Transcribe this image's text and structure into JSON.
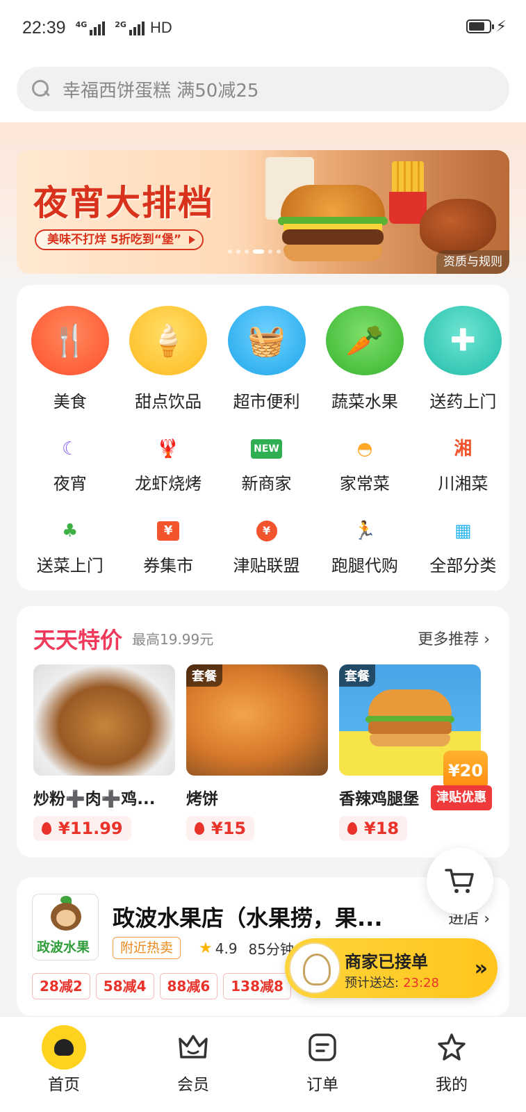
{
  "status_bar": {
    "time": "22:39",
    "network1": "4G",
    "network2": "2G",
    "hd": "HD"
  },
  "search": {
    "placeholder": "幸福西饼蛋糕 满50减25"
  },
  "banner": {
    "title": "夜宵大排档",
    "subtitle": "美味不打烊 5折吃到“堡”",
    "rule_label": "资质与规则",
    "active_dot": 3
  },
  "categories_main": [
    {
      "label": "美食",
      "icon": "spoon-fork-icon",
      "color": "#ff5a3c"
    },
    {
      "label": "甜点饮品",
      "icon": "ice-cream-icon",
      "color": "#ffc22e"
    },
    {
      "label": "超市便利",
      "icon": "basket-icon",
      "color": "#2fb7f0"
    },
    {
      "label": "蔬菜水果",
      "icon": "carrot-icon",
      "color": "#4cc241"
    },
    {
      "label": "送药上门",
      "icon": "medicine-box-icon",
      "color": "#2dc7b5"
    }
  ],
  "categories_row2": [
    {
      "label": "夜宵",
      "icon": "moon-icon",
      "glyph": "☾",
      "color": "#8a5cf5"
    },
    {
      "label": "龙虾烧烤",
      "icon": "lobster-icon",
      "glyph": "🦞",
      "color": "#f2542d"
    },
    {
      "label": "新商家",
      "icon": "new-shop-icon",
      "glyph": "NEW",
      "color": "#2fae52"
    },
    {
      "label": "家常菜",
      "icon": "bowl-icon",
      "glyph": "◓",
      "color": "#ffa726"
    },
    {
      "label": "川湘菜",
      "icon": "xiang-icon",
      "glyph": "湘",
      "color": "#f2542d"
    }
  ],
  "categories_row3": [
    {
      "label": "送菜上门",
      "icon": "broccoli-icon",
      "glyph": "♣",
      "color": "#3cb043"
    },
    {
      "label": "券集市",
      "icon": "coupon-icon",
      "glyph": "¥",
      "color": "#f2542d"
    },
    {
      "label": "津贴联盟",
      "icon": "money-bag-icon",
      "glyph": "¥",
      "color": "#f2542d"
    },
    {
      "label": "跑腿代购",
      "icon": "runner-icon",
      "glyph": "🏃",
      "color": "#f2542d"
    },
    {
      "label": "全部分类",
      "icon": "grid-icon",
      "glyph": "▦",
      "color": "#2fb7f0"
    }
  ],
  "deals": {
    "title": "天天特价",
    "subtitle": "最高19.99元",
    "more": "更多推荐 ›",
    "items": [
      {
        "name": "炒粉➕肉➕鸡...",
        "price": "¥11.99",
        "tag": ""
      },
      {
        "name": "烤饼",
        "price": "¥15",
        "tag": "套餐"
      },
      {
        "name": "香辣鸡腿堡",
        "price": "¥18",
        "tag": "套餐"
      }
    ],
    "subsidy_amount": "¥20",
    "subsidy_label": "津贴优惠"
  },
  "shop": {
    "logo_text": "政波水果",
    "name": "政波水果店（水果捞，果...",
    "enter": "进店 ›",
    "hot_tag": "附近热卖",
    "rating": "4.9",
    "eta": "85分钟",
    "promos": [
      "28减2",
      "58减4",
      "88减6",
      "138减8"
    ]
  },
  "order_status": {
    "title": "商家已接单",
    "eta_label": "预计送达:",
    "eta_time": "23:28",
    "arrow": "»"
  },
  "tabbar": [
    {
      "label": "首页",
      "icon": "home-icon",
      "active": true
    },
    {
      "label": "会员",
      "icon": "crown-icon",
      "active": false
    },
    {
      "label": "订单",
      "icon": "order-icon",
      "active": false
    },
    {
      "label": "我的",
      "icon": "profile-icon",
      "active": false
    }
  ]
}
